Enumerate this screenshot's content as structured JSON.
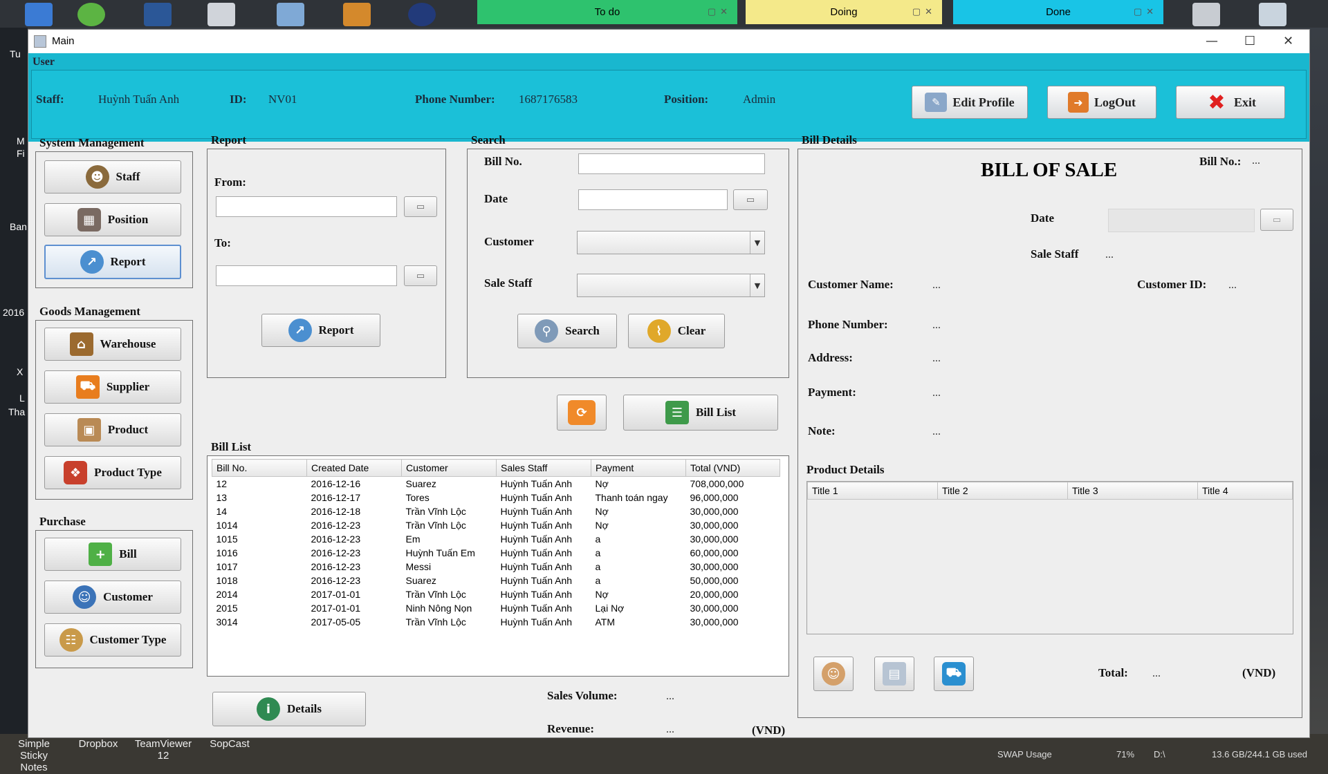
{
  "desktop": {
    "left_labels": [
      "Tu",
      "M",
      "Fi",
      "Ban",
      "2016",
      "X",
      "L",
      "Tha"
    ],
    "taskbar": [
      {
        "label": "Simple Sticky",
        "sub": "Notes"
      },
      {
        "label": "Dropbox",
        "sub": ""
      },
      {
        "label": "TeamViewer",
        "sub": "12"
      },
      {
        "label": "SopCast",
        "sub": ""
      }
    ],
    "usage": {
      "swap_label": "SWAP Usage",
      "swap_value": "71%",
      "drive": "D:\\",
      "drive_value": "13.6 GB/244.1 GB used"
    }
  },
  "sticky_notes": [
    {
      "label": "To do",
      "color": "#2ec26e"
    },
    {
      "label": "Doing",
      "color": "#f4e98a"
    },
    {
      "label": "Done",
      "color": "#19c4e6"
    }
  ],
  "window": {
    "title": "Main"
  },
  "user": {
    "section_label": "User",
    "staff_label": "Staff:",
    "staff_value": "Huỳnh Tuấn Anh",
    "id_label": "ID:",
    "id_value": "NV01",
    "phone_label": "Phone Number:",
    "phone_value": "1687176583",
    "position_label": "Position:",
    "position_value": "Admin",
    "edit_profile": "Edit Profile",
    "logout": "LogOut",
    "exit": "Exit"
  },
  "system_management": {
    "title": "System Management",
    "staff": "Staff",
    "position": "Position",
    "report": "Report"
  },
  "goods_management": {
    "title": "Goods Management",
    "warehouse": "Warehouse",
    "supplier": "Supplier",
    "product": "Product",
    "product_type": "Product Type"
  },
  "purchase": {
    "title": "Purchase",
    "bill": "Bill",
    "customer": "Customer",
    "customer_type": "Customer Type"
  },
  "report": {
    "title": "Report",
    "from_label": "From:",
    "to_label": "To:",
    "button": "Report"
  },
  "search": {
    "title": "Search",
    "bill_no": "Bill No.",
    "date": "Date",
    "customer": "Customer",
    "sale_staff": "Sale Staff",
    "search_btn": "Search",
    "clear_btn": "Clear"
  },
  "bill_list_btn": "Bill List",
  "bill_list": {
    "title": "Bill List",
    "columns": [
      "Bill No.",
      "Created Date",
      "Customer",
      "Sales Staff",
      "Payment",
      "Total  (VND)"
    ],
    "rows": [
      [
        "12",
        "2016-12-16",
        "Suarez",
        "Huỳnh Tuấn Anh",
        "Nợ",
        "708,000,000"
      ],
      [
        "13",
        "2016-12-17",
        "Tores",
        "Huỳnh Tuấn Anh",
        "Thanh toán ngay",
        "96,000,000"
      ],
      [
        "14",
        "2016-12-18",
        "Trần Vĩnh Lộc",
        "Huỳnh Tuấn Anh",
        "Nợ",
        "30,000,000"
      ],
      [
        "1014",
        "2016-12-23",
        "Trần Vĩnh Lộc",
        "Huỳnh Tuấn Anh",
        "Nợ",
        "30,000,000"
      ],
      [
        "1015",
        "2016-12-23",
        "Em",
        "Huỳnh Tuấn Anh",
        "a",
        "30,000,000"
      ],
      [
        "1016",
        "2016-12-23",
        "Huỳnh Tuấn Em",
        "Huỳnh Tuấn Anh",
        "a",
        "60,000,000"
      ],
      [
        "1017",
        "2016-12-23",
        "Messi",
        "Huỳnh Tuấn Anh",
        "a",
        "30,000,000"
      ],
      [
        "1018",
        "2016-12-23",
        "Suarez",
        "Huỳnh Tuấn Anh",
        "a",
        "50,000,000"
      ],
      [
        "2014",
        "2017-01-01",
        "Trần Vĩnh Lộc",
        "Huỳnh Tuấn Anh",
        "Nợ",
        "20,000,000"
      ],
      [
        "2015",
        "2017-01-01",
        "Ninh Nông Nọn",
        "Huỳnh Tuấn Anh",
        "Lại Nợ",
        "30,000,000"
      ],
      [
        "3014",
        "2017-05-05",
        "Trần Vĩnh Lộc",
        "Huỳnh Tuấn Anh",
        "ATM",
        "30,000,000"
      ]
    ]
  },
  "details_btn": "Details",
  "summary": {
    "sales_volume_label": "Sales Volume:",
    "sales_volume": "...",
    "revenue_label": "Revenue:",
    "revenue": "...",
    "unit": "(VND)"
  },
  "bill_details": {
    "title": "Bill Details",
    "heading": "BILL OF SALE",
    "bill_no_label": "Bill No.:",
    "bill_no": "...",
    "date_label": "Date",
    "sale_staff_label": "Sale Staff",
    "sale_staff": "...",
    "customer_name_label": "Customer Name:",
    "customer_name": "...",
    "customer_id_label": "Customer ID:",
    "customer_id": "...",
    "phone_label": "Phone Number:",
    "phone": "...",
    "address_label": "Address:",
    "address": "...",
    "payment_label": "Payment:",
    "payment": "...",
    "note_label": "Note:",
    "note": "...",
    "product_details": "Product Details",
    "product_columns": [
      "Title 1",
      "Title 2",
      "Title 3",
      "Title 4"
    ],
    "total_label": "Total:",
    "total": "...",
    "total_unit": "(VND)"
  }
}
